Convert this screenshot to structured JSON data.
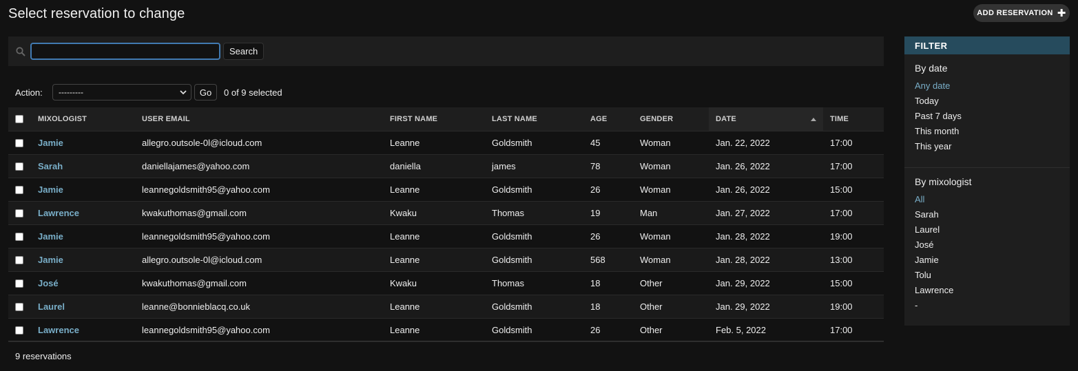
{
  "page": {
    "title": "Select reservation to change",
    "add_button_label": "ADD RESERVATION",
    "add_button_icon": "plus-icon"
  },
  "search": {
    "value": "",
    "placeholder": "",
    "button_label": "Search",
    "icon": "search-icon"
  },
  "actions": {
    "label": "Action:",
    "selected_option": "---------",
    "go_label": "Go",
    "selected_count": "0 of 9 selected"
  },
  "table": {
    "columns": {
      "mixologist": "MIXOLOGIST",
      "user_email": "USER EMAIL",
      "first_name": "FIRST NAME",
      "last_name": "LAST NAME",
      "age": "AGE",
      "gender": "GENDER",
      "date": "DATE",
      "time": "TIME"
    },
    "sorted_column": "date",
    "sort_direction": "ascending",
    "rows": [
      {
        "mixologist": "Jamie",
        "email": "allegro.outsole-0l@icloud.com",
        "first_name": "Leanne",
        "last_name": "Goldsmith",
        "age": "45",
        "gender": "Woman",
        "date": "Jan. 22, 2022",
        "time": "17:00"
      },
      {
        "mixologist": "Sarah",
        "email": "daniellajames@yahoo.com",
        "first_name": "daniella",
        "last_name": "james",
        "age": "78",
        "gender": "Woman",
        "date": "Jan. 26, 2022",
        "time": "17:00"
      },
      {
        "mixologist": "Jamie",
        "email": "leannegoldsmith95@yahoo.com",
        "first_name": "Leanne",
        "last_name": "Goldsmith",
        "age": "26",
        "gender": "Woman",
        "date": "Jan. 26, 2022",
        "time": "15:00"
      },
      {
        "mixologist": "Lawrence",
        "email": "kwakuthomas@gmail.com",
        "first_name": "Kwaku",
        "last_name": "Thomas",
        "age": "19",
        "gender": "Man",
        "date": "Jan. 27, 2022",
        "time": "17:00"
      },
      {
        "mixologist": "Jamie",
        "email": "leannegoldsmith95@yahoo.com",
        "first_name": "Leanne",
        "last_name": "Goldsmith",
        "age": "26",
        "gender": "Woman",
        "date": "Jan. 28, 2022",
        "time": "19:00"
      },
      {
        "mixologist": "Jamie",
        "email": "allegro.outsole-0l@icloud.com",
        "first_name": "Leanne",
        "last_name": "Goldsmith",
        "age": "568",
        "gender": "Woman",
        "date": "Jan. 28, 2022",
        "time": "13:00"
      },
      {
        "mixologist": "José",
        "email": "kwakuthomas@gmail.com",
        "first_name": "Kwaku",
        "last_name": "Thomas",
        "age": "18",
        "gender": "Other",
        "date": "Jan. 29, 2022",
        "time": "15:00"
      },
      {
        "mixologist": "Laurel",
        "email": "leanne@bonnieblacq.co.uk",
        "first_name": "Leanne",
        "last_name": "Goldsmith",
        "age": "18",
        "gender": "Other",
        "date": "Jan. 29, 2022",
        "time": "19:00"
      },
      {
        "mixologist": "Lawrence",
        "email": "leannegoldsmith95@yahoo.com",
        "first_name": "Leanne",
        "last_name": "Goldsmith",
        "age": "26",
        "gender": "Other",
        "date": "Feb. 5, 2022",
        "time": "17:00"
      }
    ],
    "footer": "9 reservations"
  },
  "filter": {
    "title": "FILTER",
    "groups": [
      {
        "title": "By date",
        "selected": "Any date",
        "items": [
          "Any date",
          "Today",
          "Past 7 days",
          "This month",
          "This year"
        ]
      },
      {
        "title": "By mixologist",
        "selected": "All",
        "items": [
          "All",
          "Sarah",
          "Laurel",
          "José",
          "Jamie",
          "Tolu",
          "Lawrence",
          "-"
        ]
      }
    ]
  },
  "colors": {
    "background": "#121212",
    "link": "#79aec8",
    "filter_header_bg": "#264b5d",
    "input_focus_border": "#417ab2"
  }
}
